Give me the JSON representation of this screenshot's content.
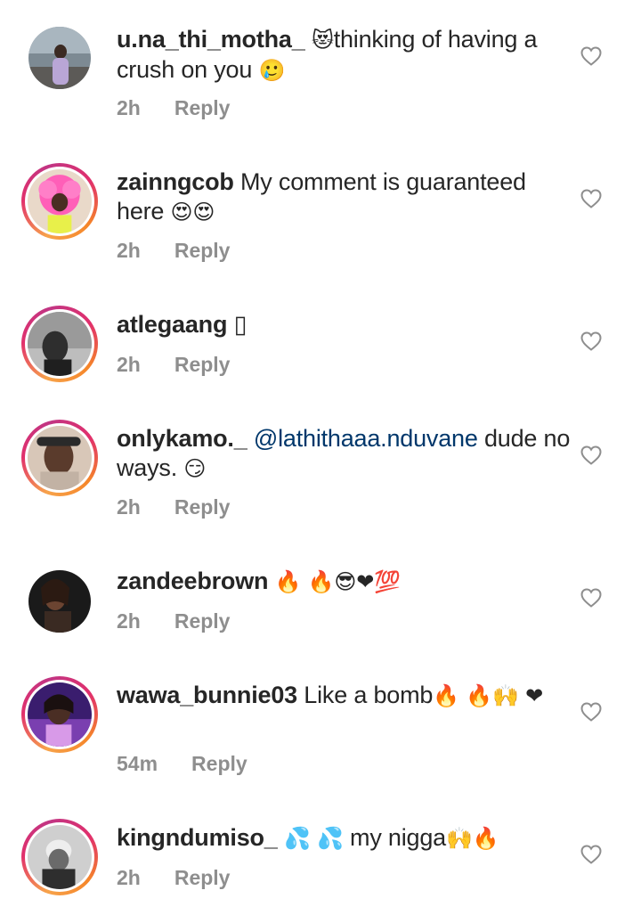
{
  "comments": [
    {
      "username": "u.na_thi_motha_",
      "emoji_lead": "😻",
      "text": "thinking of having a crush on you ",
      "emoji_tail": "🥲",
      "time": "2h",
      "reply_label": "Reply"
    },
    {
      "username": "zainngcob",
      "text": "My comment is guaranteed here ",
      "emoji_tail": "😍😍",
      "time": "2h",
      "reply_label": "Reply"
    },
    {
      "username": "atlegaang",
      "text": "",
      "emoji_tail": "▯",
      "time": "2h",
      "reply_label": "Reply"
    },
    {
      "username": "onlykamo._",
      "mention": "@lathithaaa.nduvane",
      "text": " dude no ways. ",
      "emoji_tail": "😏",
      "time": "2h",
      "reply_label": "Reply"
    },
    {
      "username": "zandeebrown",
      "text": "",
      "emoji_tail": "🔥 🔥😎❤💯",
      "time": "2h",
      "reply_label": "Reply"
    },
    {
      "username": "wawa_bunnie03",
      "text": "Like a bomb",
      "emoji_tail": "🔥 🔥🙌 ❤",
      "time": "54m",
      "reply_label": "Reply"
    },
    {
      "username": "kingndumiso_",
      "text": " my nigga",
      "emoji_lead": "💦 💦",
      "emoji_tail": "🙌🔥",
      "time": "2h",
      "reply_label": "Reply"
    }
  ],
  "icons": {
    "like": "heart-outline-icon"
  },
  "colors": {
    "text": "#262626",
    "meta": "#8e8e8e",
    "mention": "#00376b"
  }
}
